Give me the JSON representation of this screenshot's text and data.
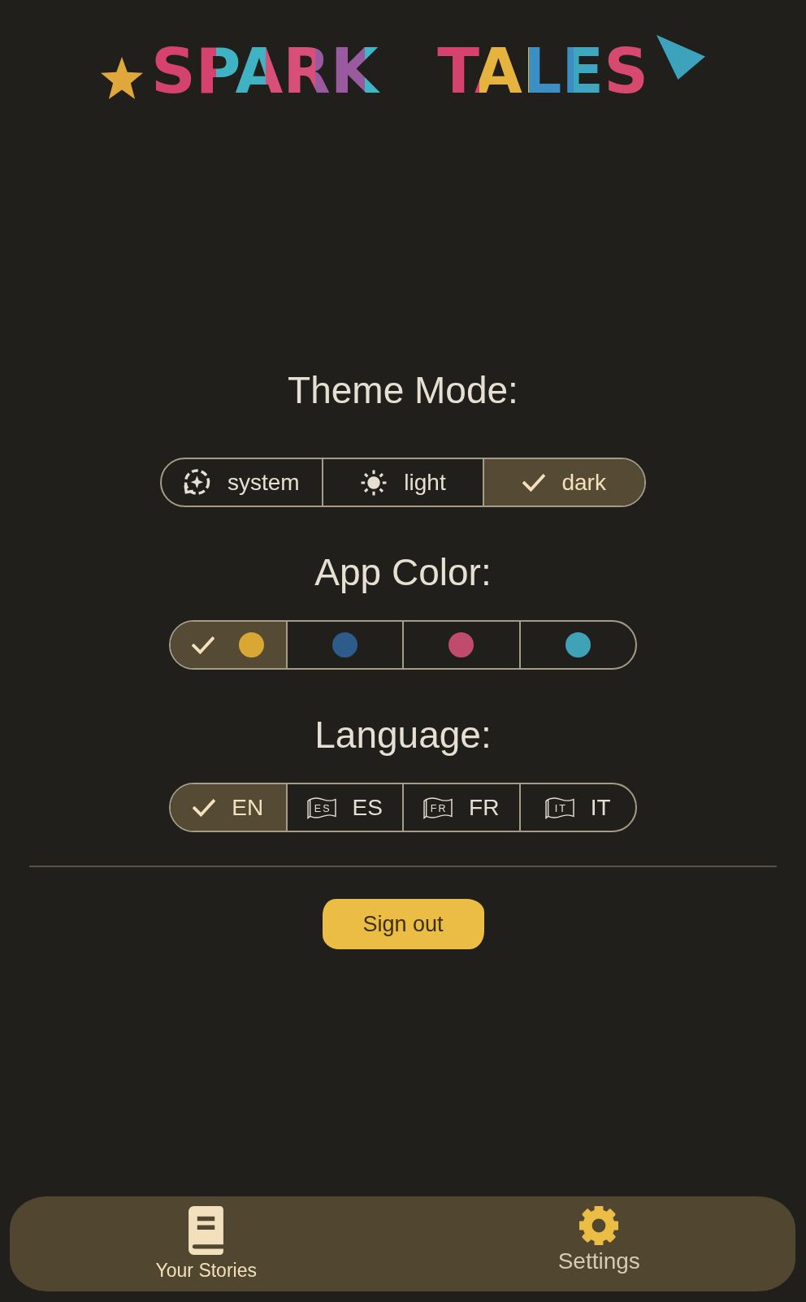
{
  "logo": {
    "text": "SPARK TALES"
  },
  "theme_mode": {
    "heading": "Theme Mode:",
    "options": [
      {
        "label": "system",
        "selected": false
      },
      {
        "label": "light",
        "selected": false
      },
      {
        "label": "dark",
        "selected": true
      }
    ]
  },
  "app_color": {
    "heading": "App Color:",
    "options": [
      {
        "color": "#d9a834",
        "selected": true
      },
      {
        "color": "#2d5b8a",
        "selected": false
      },
      {
        "color": "#c04b6c",
        "selected": false
      },
      {
        "color": "#40a2b6",
        "selected": false
      }
    ]
  },
  "language": {
    "heading": "Language:",
    "options": [
      {
        "label": "EN",
        "selected": true
      },
      {
        "label": "ES",
        "flag_text": "ES",
        "selected": false
      },
      {
        "label": "FR",
        "flag_text": "FR",
        "selected": false
      },
      {
        "label": "IT",
        "flag_text": "IT",
        "selected": false
      }
    ]
  },
  "sign_out": {
    "label": "Sign out"
  },
  "bottom_nav": {
    "items": [
      {
        "label": "Your Stories",
        "selected": false
      },
      {
        "label": "Settings",
        "selected": true
      }
    ]
  }
}
